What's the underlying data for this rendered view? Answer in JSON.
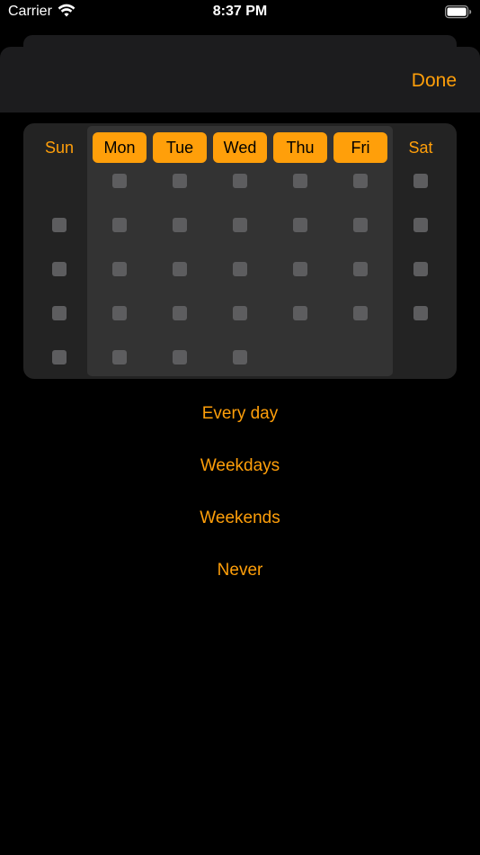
{
  "status_bar": {
    "carrier": "Carrier",
    "time": "8:37 PM"
  },
  "header": {
    "done_label": "Done"
  },
  "days": [
    {
      "label": "Sun",
      "selected": false
    },
    {
      "label": "Mon",
      "selected": true
    },
    {
      "label": "Tue",
      "selected": true
    },
    {
      "label": "Wed",
      "selected": true
    },
    {
      "label": "Thu",
      "selected": true
    },
    {
      "label": "Fri",
      "selected": true
    },
    {
      "label": "Sat",
      "selected": false
    }
  ],
  "calendar_grid": [
    [
      false,
      true,
      true,
      true,
      true,
      true,
      true
    ],
    [
      true,
      true,
      true,
      true,
      true,
      true,
      true
    ],
    [
      true,
      true,
      true,
      true,
      true,
      true,
      true
    ],
    [
      true,
      true,
      true,
      true,
      true,
      true,
      true
    ],
    [
      true,
      true,
      true,
      true,
      false,
      false,
      false
    ]
  ],
  "options": [
    "Every day",
    "Weekdays",
    "Weekends",
    "Never"
  ],
  "colors": {
    "accent": "#ff9f0a",
    "background": "#000000",
    "card": "#232323",
    "weekday_block": "#333333",
    "cell": "#5d5d5f"
  }
}
